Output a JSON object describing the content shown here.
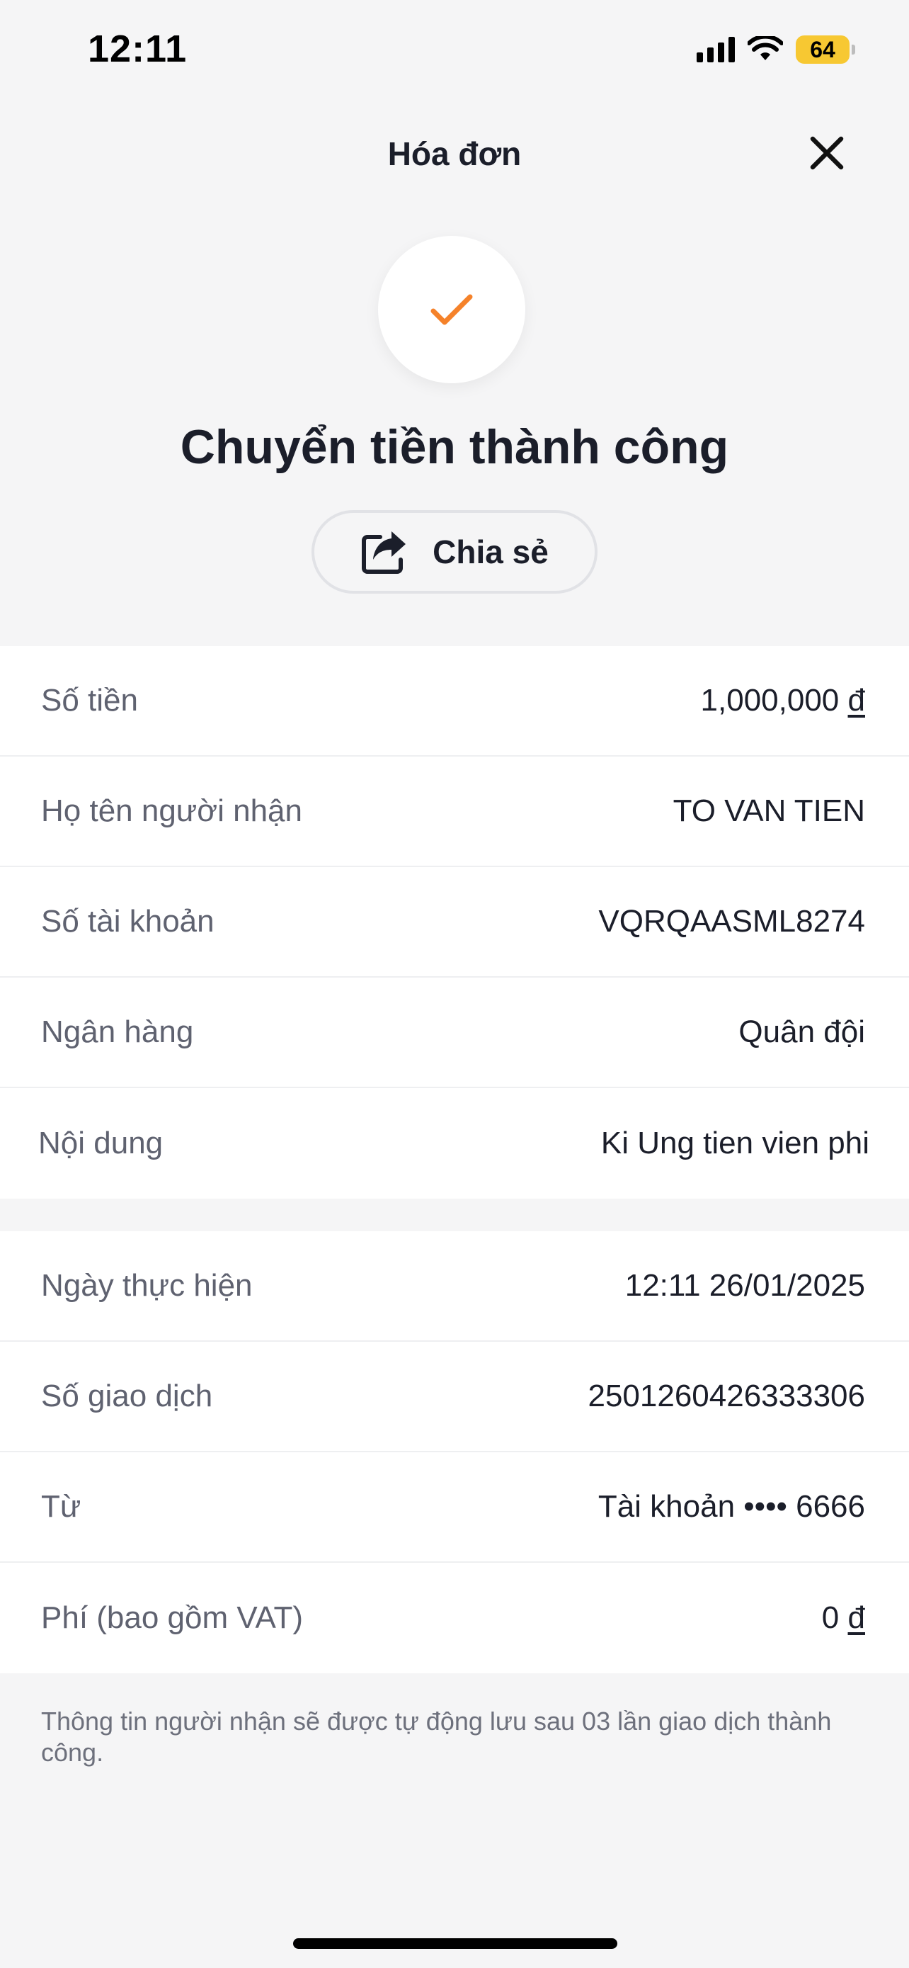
{
  "status_bar": {
    "time": "12:11",
    "battery": "64"
  },
  "header": {
    "title": "Hóa đơn"
  },
  "result": {
    "title": "Chuyển tiền thành công",
    "share_label": "Chia sẻ",
    "accent_color": "#f5822a"
  },
  "details": [
    {
      "label": "Số tiền",
      "value": "1,000,000",
      "currency": "đ"
    },
    {
      "label": "Họ tên người nhận",
      "value": "TO VAN TIEN"
    },
    {
      "label": "Số tài khoản",
      "value": "VQRQAASML8274"
    },
    {
      "label": "Ngân hàng",
      "value": "Quân đội"
    },
    {
      "label": "Nội dung",
      "value": "Ki Ung tien vien phi"
    }
  ],
  "transaction": [
    {
      "label": "Ngày thực hiện",
      "value": "12:11 26/01/2025"
    },
    {
      "label": "Số giao dịch",
      "value": "2501260426333306"
    },
    {
      "label": "Từ",
      "value": "Tài khoản •••• 6666"
    },
    {
      "label": "Phí (bao gồm VAT)",
      "value": "0",
      "currency": "đ"
    }
  ],
  "footer_note": "Thông tin người nhận sẽ được tự động lưu sau 03 lần giao dịch thành công."
}
